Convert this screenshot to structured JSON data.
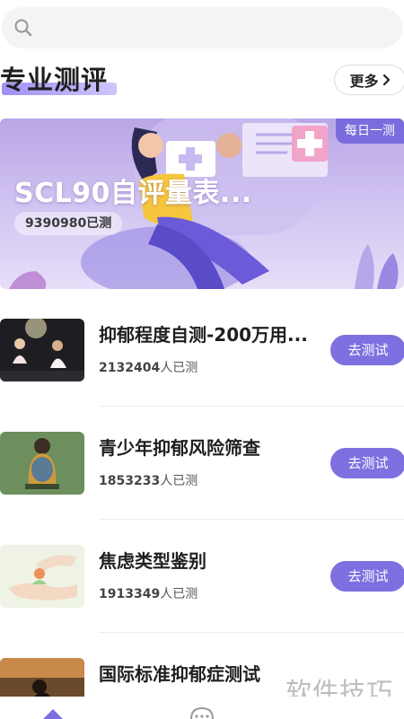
{
  "search": {
    "icon": "search-icon"
  },
  "section": {
    "title": "专业测评",
    "more_label": "更多"
  },
  "banner": {
    "tag": "每日一测",
    "title": "SCL90自评量表...",
    "count": "9390980已测"
  },
  "items": [
    {
      "title": "抑郁程度自测-200万用...",
      "count": "2132404",
      "count_suffix": "人已测",
      "button": "去测试"
    },
    {
      "title": "青少年抑郁风险筛查",
      "count": "1853233",
      "count_suffix": "人已测",
      "button": "去测试"
    },
    {
      "title": "焦虑类型鉴别",
      "count": "1913349",
      "count_suffix": "人已测",
      "button": "去测试"
    },
    {
      "title": "国际标准抑郁症测试"
    }
  ],
  "watermark": "软件技巧",
  "tabs": {
    "home_icon": "home-icon",
    "message_icon": "message-icon"
  },
  "colors": {
    "accent": "#7d70e0",
    "banner_tag": "#7a6cdc"
  }
}
